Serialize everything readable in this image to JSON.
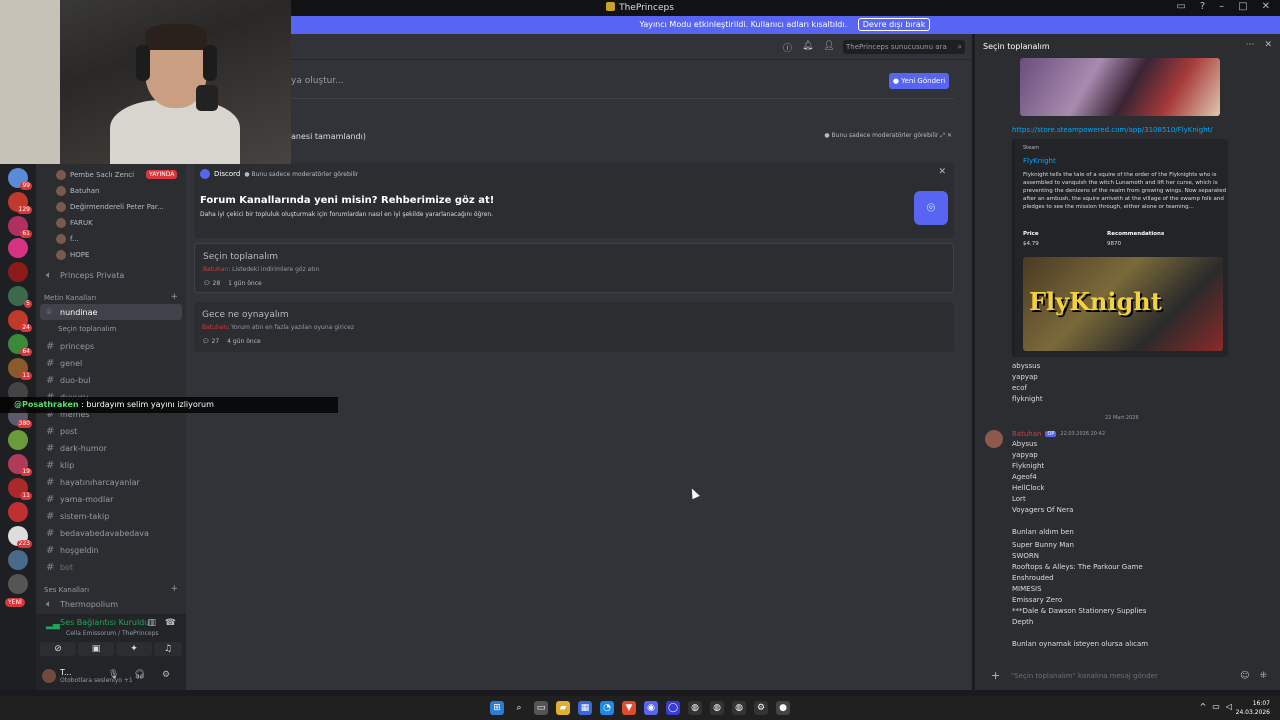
{
  "window": {
    "title": "ThePrinceps"
  },
  "banner": {
    "text": "Yayıncı Modu etkinleştirildi. Kullanıcı adları kısaltıldı.",
    "button": "Devre dışı bırak"
  },
  "rail": {
    "badges": [
      "99",
      "129",
      "61",
      "5",
      "24",
      "64",
      "11",
      "380",
      "19",
      "11",
      "223"
    ],
    "new_label": "YENİ"
  },
  "sidebar": {
    "voice_users": [
      "Pembe Saclı Zenci",
      "Batuhan",
      "Değirmendereli Peter Par...",
      "FARUK",
      "f...",
      "HOPE"
    ],
    "live_label": "YAYINDA",
    "princeps_privata": "Princeps Privata",
    "category_text": "Metin Kanalları",
    "active_channel": "nundinae",
    "active_sub": "Seçin toplanalım",
    "channels": [
      "princeps",
      "genel",
      "duo-bul",
      "duyuru",
      "memes",
      "post",
      "dark-humor",
      "klip",
      "hayatınıharcayanlar",
      "yama-modlar",
      "sistem-takip",
      "bedavabedavabedava",
      "hoşgeldin",
      "bot"
    ],
    "category_voice": "Ses Kanalları",
    "voice_channel": "Thermopolium"
  },
  "voice_panel": {
    "status": "Ses Bağlantısı Kuruldu",
    "location": "Cella Emissorum / ThePrinceps",
    "user_name": "T...",
    "user_status": "Otobotlara sesleniyo +1"
  },
  "main": {
    "search_placeholder": "ThePrinceps sunucusunu ara",
    "new_post_prompt": "ya oluştur...",
    "new_post_button": "Yeni Gönderi",
    "guideline_text": "anesi tamamlandı)",
    "mod_only": "Bunu sadece moderatörler görebilir",
    "card": {
      "source": "Discord",
      "mod_only": "Bunu sadece moderatörler görebilir",
      "heading": "Forum Kanallarında yeni misin? Rehberimize göz at!",
      "body": "Daha iyi çekici bir topluluk oluşturmak için forumlardan nasıl en iyi şekilde yararlanacağını öğren."
    },
    "posts": [
      {
        "title": "Seçin toplanalım",
        "author": "Batuhan",
        "snippet": ": Listedeki indirimlere göz atın",
        "count": "28",
        "time": "1 gün önce"
      },
      {
        "title": "Gece ne oynayalım",
        "author": "Batuhan",
        "snippet": ": Yorum atın en fazla yazılan oyuna giricez",
        "count": "27",
        "time": "4 gün önce"
      }
    ]
  },
  "chat_overlay": {
    "user": "@Posathraken",
    "text": ": burdayım selim yayını izliyorum"
  },
  "thread": {
    "header": "Seçin toplanalım",
    "link": "https://store.steampowered.com/app/3108510/FlyKnight/",
    "embed": {
      "provider": "Steam",
      "title": "FlyKnight",
      "description": "Flyknight tells the tale of a squire of the order of the Flyknights who is assembled to vanquish the witch Lunamoth and lift her curse, which is preventing the denizens of the realm from growing wings. Now separated after an ambush, the squire arriveth at the village of the swamp folk and pledges to see the mission through, either alone or teaming...",
      "price_label": "Price",
      "price": "$4.79",
      "rec_label": "Recommendations",
      "rec": "9870",
      "image_logo": "FlyKnight"
    },
    "list1": [
      "abyssus",
      "yapyap",
      "ecof",
      "flyknight"
    ],
    "date_sep": "22 Mart 2026",
    "msg_author": "Batuhan",
    "msg_tag": "OP",
    "msg_time": "22.03.2026 20:42",
    "list2": [
      "Abysus",
      "yapyap",
      "Flyknight",
      "Ageof4",
      "HellClock",
      "Lort",
      "Voyagers Of Nera"
    ],
    "bought_label": "Bunları aldım ben",
    "list3": [
      "Super Bunny Man",
      "SWORN",
      "Rooftops & Alleys: The Parkour Game",
      "Enshrouded",
      "MIMESIS",
      "Emissary Zero",
      "***Dale & Dawson Stationery Supplies",
      "Depth"
    ],
    "closing": "Bunları oynamak isteyen olursa alıcam",
    "composer_placeholder": "\"Seçin toplanalım\" kanalına mesaj gönder"
  },
  "taskbar": {
    "time": "16:07",
    "date": "24.03.2026"
  }
}
